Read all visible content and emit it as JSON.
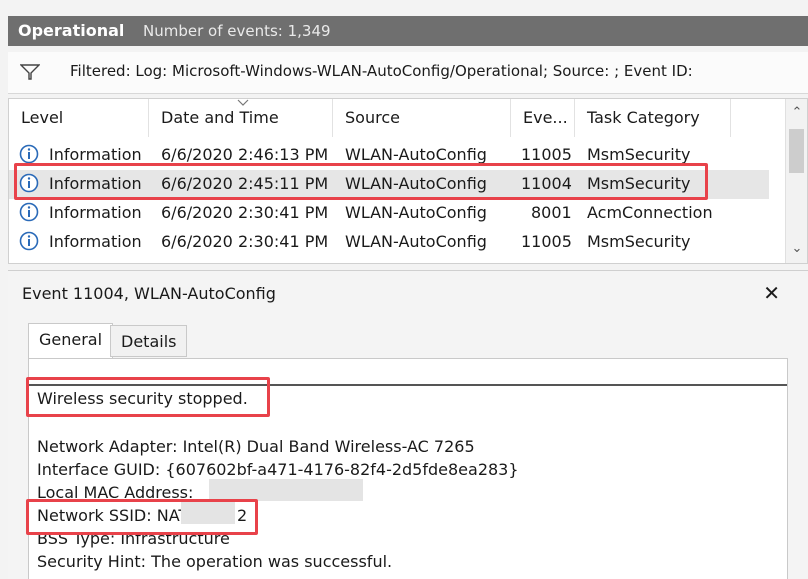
{
  "header": {
    "title": "Operational",
    "count_text": "Number of events: 1,349"
  },
  "filter": {
    "text": "Filtered: Log: Microsoft-Windows-WLAN-AutoConfig/Operational; Source: ; Event ID:",
    "icon": "filter-funnel-icon"
  },
  "columns": [
    "Level",
    "Date and Time",
    "Source",
    "Eve...",
    "Task Category"
  ],
  "rows": [
    {
      "level": "Information",
      "datetime": "6/6/2020 2:46:13 PM",
      "source": "WLAN-AutoConfig",
      "event": "11005",
      "category": "MsmSecurity"
    },
    {
      "level": "Information",
      "datetime": "6/6/2020 2:45:11 PM",
      "source": "WLAN-AutoConfig",
      "event": "11004",
      "category": "MsmSecurity"
    },
    {
      "level": "Information",
      "datetime": "6/6/2020 2:30:41 PM",
      "source": "WLAN-AutoConfig",
      "event": "8001",
      "category": "AcmConnection"
    },
    {
      "level": "Information",
      "datetime": "6/6/2020 2:30:41 PM",
      "source": "WLAN-AutoConfig",
      "event": "11005",
      "category": "MsmSecurity"
    }
  ],
  "detail": {
    "title": "Event 11004, WLAN-AutoConfig",
    "close_glyph": "✕",
    "tabs": [
      "General",
      "Details"
    ],
    "lines": [
      "Wireless security stopped.",
      "Network Adapter: Intel(R) Dual Band Wireless-AC 7265",
      "Interface GUID: {607602bf-a471-4176-82f4-2d5fde8ea283}",
      "Local MAC Address:",
      "Network SSID: NAT",
      "2",
      "BSS Type: Infrastructure",
      "Security Hint: The operation was successful."
    ]
  },
  "colors": {
    "highlight": "#e8424a",
    "header_bg": "#6f6f6f",
    "info_icon": "#2a6ab8"
  }
}
